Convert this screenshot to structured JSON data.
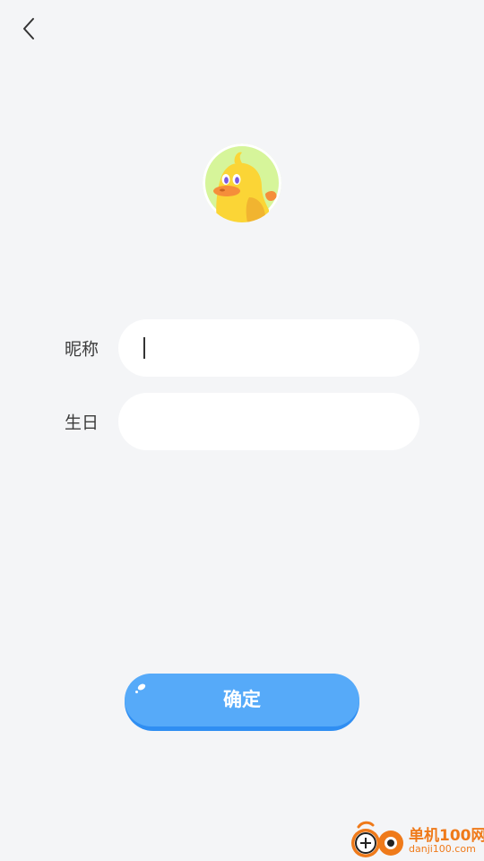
{
  "header": {
    "back_icon": "chevron-left-icon"
  },
  "profile": {
    "avatar_icon": "yellow-duck-avatar",
    "avatar_bg_color": "#d6f59a",
    "duck_color": "#fbd536"
  },
  "form": {
    "nickname": {
      "label": "昵称",
      "value": ""
    },
    "birthday": {
      "label": "生日",
      "value": ""
    }
  },
  "actions": {
    "confirm_label": "确定",
    "accent_color": "#56aaf9"
  },
  "watermark": {
    "title": "单机100网",
    "url": "danji100.com",
    "color": "#ef7a1a"
  }
}
